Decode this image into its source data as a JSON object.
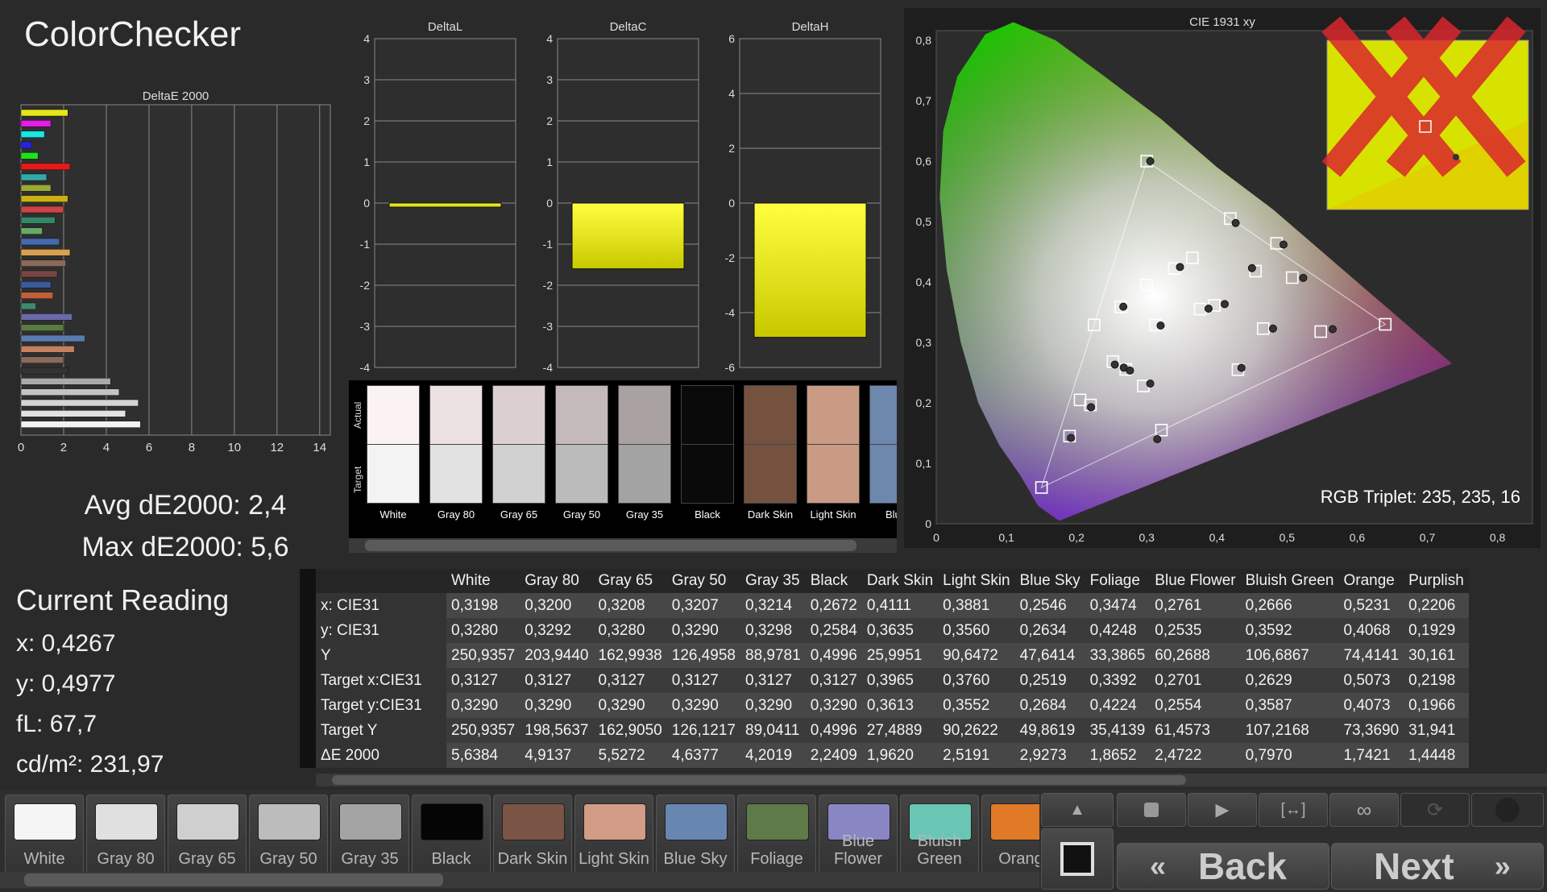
{
  "app": {
    "title": "ColorChecker"
  },
  "deltaE_chart": {
    "title": "DeltaE 2000",
    "x_ticks": [
      "0",
      "2",
      "4",
      "6",
      "8",
      "10",
      "12",
      "14"
    ]
  },
  "stats": {
    "avg": "Avg dE2000: 2,4",
    "max": "Max dE2000: 5,6"
  },
  "deltaL": {
    "title": "DeltaL",
    "ticks": [
      "4",
      "3",
      "2",
      "1",
      "0",
      "-1",
      "-2",
      "-3",
      "-4"
    ]
  },
  "deltaC": {
    "title": "DeltaC",
    "ticks": [
      "4",
      "3",
      "2",
      "1",
      "0",
      "-1",
      "-2",
      "-3",
      "-4"
    ]
  },
  "deltaH": {
    "title": "DeltaH",
    "ticks": [
      "6",
      "4",
      "2",
      "0",
      "-2",
      "-4",
      "-6"
    ]
  },
  "swatches": {
    "actual_label": "Actual",
    "target_label": "Target",
    "items": [
      {
        "name": "White",
        "actual": "#fbf2f2",
        "target": "#f3f3f3"
      },
      {
        "name": "Gray 80",
        "actual": "#ece1e1",
        "target": "#e2e2e2"
      },
      {
        "name": "Gray 65",
        "actual": "#dccfcf",
        "target": "#d1d1d1"
      },
      {
        "name": "Gray 50",
        "actual": "#c4baba",
        "target": "#bbbbbb"
      },
      {
        "name": "Gray 35",
        "actual": "#aaa1a1",
        "target": "#a3a3a3"
      },
      {
        "name": "Black",
        "actual": "#0a0a0a",
        "target": "#0a0a0a"
      },
      {
        "name": "Dark Skin",
        "actual": "#75513f",
        "target": "#75513f"
      },
      {
        "name": "Light Skin",
        "actual": "#c99a84",
        "target": "#c99a84"
      },
      {
        "name": "Blue",
        "actual": "#6d87ad",
        "target": "#6d87ad"
      }
    ]
  },
  "cie": {
    "title": "CIE 1931 xy",
    "x_ticks": [
      "0",
      "0,1",
      "0,2",
      "0,3",
      "0,4",
      "0,5",
      "0,6",
      "0,7",
      "0,8"
    ],
    "y_ticks": [
      "0",
      "0,1",
      "0,2",
      "0,3",
      "0,4",
      "0,5",
      "0,6",
      "0,7",
      "0,8"
    ],
    "rgb_triplet": "RGB Triplet: 235, 235, 16",
    "current_point": {
      "x": 0.4267,
      "y": 0.4977
    },
    "targets": [
      [
        0.64,
        0.33
      ],
      [
        0.3,
        0.6
      ],
      [
        0.15,
        0.06
      ],
      [
        0.3127,
        0.329
      ],
      [
        0.225,
        0.329
      ],
      [
        0.321,
        0.155
      ],
      [
        0.419,
        0.505
      ],
      [
        0.3965,
        0.3613
      ],
      [
        0.376,
        0.3552
      ],
      [
        0.2519,
        0.2684
      ],
      [
        0.3392,
        0.4224
      ],
      [
        0.2701,
        0.2554
      ],
      [
        0.2629,
        0.3587
      ],
      [
        0.5073,
        0.4073
      ],
      [
        0.2198,
        0.1966
      ],
      [
        0.455,
        0.418
      ],
      [
        0.485,
        0.464
      ],
      [
        0.548,
        0.318
      ],
      [
        0.466,
        0.323
      ],
      [
        0.19,
        0.145
      ],
      [
        0.43,
        0.255
      ],
      [
        0.205,
        0.205
      ],
      [
        0.365,
        0.44
      ],
      [
        0.3,
        0.395
      ],
      [
        0.295,
        0.228
      ]
    ],
    "actuals": [
      [
        0.3198,
        0.328
      ],
      [
        0.2672,
        0.2584
      ],
      [
        0.4111,
        0.3635
      ],
      [
        0.3881,
        0.356
      ],
      [
        0.2546,
        0.2634
      ],
      [
        0.3474,
        0.4248
      ],
      [
        0.2761,
        0.2535
      ],
      [
        0.2666,
        0.3592
      ],
      [
        0.5231,
        0.4068
      ],
      [
        0.2206,
        0.1929
      ],
      [
        0.305,
        0.6
      ],
      [
        0.4267,
        0.4977
      ],
      [
        0.565,
        0.322
      ],
      [
        0.48,
        0.323
      ],
      [
        0.192,
        0.142
      ],
      [
        0.435,
        0.258
      ],
      [
        0.315,
        0.14
      ],
      [
        0.305,
        0.232
      ],
      [
        0.45,
        0.423
      ],
      [
        0.495,
        0.462
      ]
    ]
  },
  "current_reading": {
    "title": "Current Reading",
    "x": "x: 0,4267",
    "y": "y: 0,4977",
    "fL": "fL: 67,7",
    "cdm2": "cd/m²: 231,97"
  },
  "table": {
    "columns": [
      "White",
      "Gray 80",
      "Gray 65",
      "Gray 50",
      "Gray 35",
      "Black",
      "Dark Skin",
      "Light Skin",
      "Blue Sky",
      "Foliage",
      "Blue Flower",
      "Bluish Green",
      "Orange",
      "Purplish"
    ],
    "rows": [
      {
        "label": "x: CIE31",
        "values": [
          "0,3198",
          "0,3200",
          "0,3208",
          "0,3207",
          "0,3214",
          "0,2672",
          "0,4111",
          "0,3881",
          "0,2546",
          "0,3474",
          "0,2761",
          "0,2666",
          "0,5231",
          "0,2206"
        ]
      },
      {
        "label": "y: CIE31",
        "values": [
          "0,3280",
          "0,3292",
          "0,3280",
          "0,3290",
          "0,3298",
          "0,2584",
          "0,3635",
          "0,3560",
          "0,2634",
          "0,4248",
          "0,2535",
          "0,3592",
          "0,4068",
          "0,1929"
        ]
      },
      {
        "label": "Y",
        "values": [
          "250,9357",
          "203,9440",
          "162,9938",
          "126,4958",
          "88,9781",
          "0,4996",
          "25,9951",
          "90,6472",
          "47,6414",
          "33,3865",
          "60,2688",
          "106,6867",
          "74,4141",
          "30,161"
        ]
      },
      {
        "label": "Target x:CIE31",
        "values": [
          "0,3127",
          "0,3127",
          "0,3127",
          "0,3127",
          "0,3127",
          "0,3127",
          "0,3965",
          "0,3760",
          "0,2519",
          "0,3392",
          "0,2701",
          "0,2629",
          "0,5073",
          "0,2198"
        ]
      },
      {
        "label": "Target y:CIE31",
        "values": [
          "0,3290",
          "0,3290",
          "0,3290",
          "0,3290",
          "0,3290",
          "0,3290",
          "0,3613",
          "0,3552",
          "0,2684",
          "0,4224",
          "0,2554",
          "0,3587",
          "0,4073",
          "0,1966"
        ]
      },
      {
        "label": "Target Y",
        "values": [
          "250,9357",
          "198,5637",
          "162,9050",
          "126,1217",
          "89,0411",
          "0,4996",
          "27,4889",
          "90,2622",
          "49,8619",
          "35,4139",
          "61,4573",
          "107,2168",
          "73,3690",
          "31,941"
        ]
      },
      {
        "label": "ΔE 2000",
        "values": [
          "5,6384",
          "4,9137",
          "5,5272",
          "4,6377",
          "4,2019",
          "2,2409",
          "1,9620",
          "2,5191",
          "2,9273",
          "1,8652",
          "2,4722",
          "0,7970",
          "1,7421",
          "1,4448"
        ]
      }
    ]
  },
  "patch_buttons": [
    {
      "label": "White",
      "color": "#f5f5f5"
    },
    {
      "label": "Gray 80",
      "color": "#e0e0e0"
    },
    {
      "label": "Gray 65",
      "color": "#cfcfcf"
    },
    {
      "label": "Gray 50",
      "color": "#bcbcbc"
    },
    {
      "label": "Gray 35",
      "color": "#a4a4a4"
    },
    {
      "label": "Black",
      "color": "#050505"
    },
    {
      "label": "Dark Skin",
      "color": "#7a5445"
    },
    {
      "label": "Light Skin",
      "color": "#d29c86"
    },
    {
      "label": "Blue Sky",
      "color": "#6886b2"
    },
    {
      "label": "Foliage",
      "color": "#5e7a48"
    },
    {
      "label": "Blue Flower",
      "color": "#8a86c4"
    },
    {
      "label": "Bluish Green",
      "color": "#6ac6b4"
    },
    {
      "label": "Orang",
      "color": "#e07a26"
    }
  ],
  "nav": {
    "back": "Back",
    "next": "Next"
  },
  "colors": {
    "accent_yellow": "#ebeb10",
    "panel_bg": "#2a2a2a",
    "chart_bg": "#303030"
  }
}
